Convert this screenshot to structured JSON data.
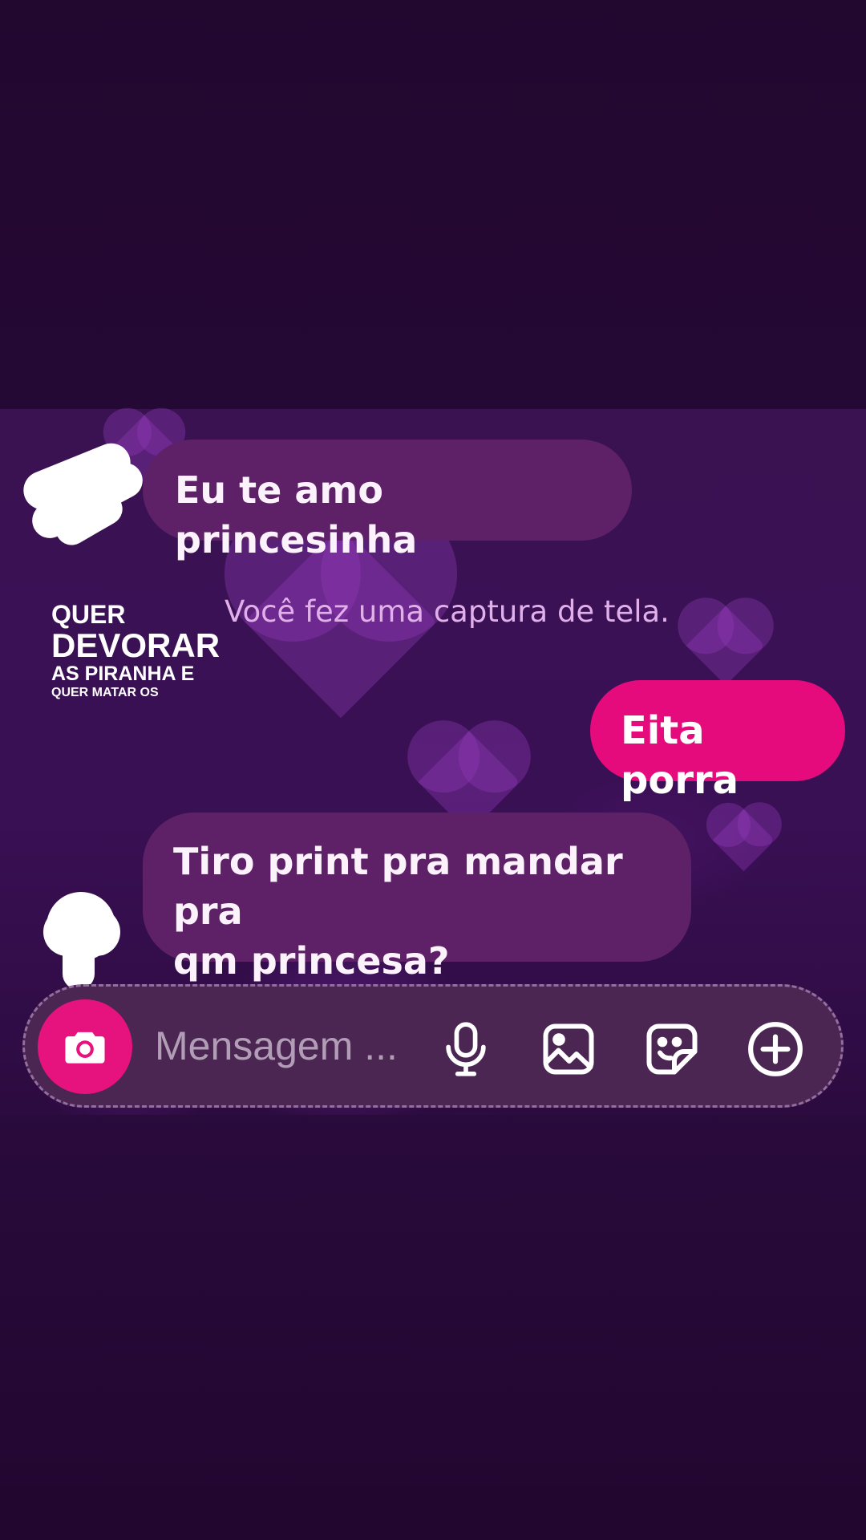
{
  "messages": [
    {
      "direction": "received",
      "text": "Eu te amo princesinha"
    },
    {
      "direction": "notice",
      "text": "Você fez uma captura de tela."
    },
    {
      "direction": "sent",
      "text": "Eita porra"
    },
    {
      "direction": "received",
      "text_lines": [
        "Tiro print pra mandar pra",
        "qm princesa?"
      ]
    }
  ],
  "overlay": {
    "line1": "QUER",
    "line2": "DEVORAR",
    "line3": "AS PIRANHA E",
    "line4": "QUER MATAR OS"
  },
  "composer": {
    "placeholder": "Mensagem ...",
    "icons": [
      "camera-icon",
      "microphone-icon",
      "gallery-icon",
      "sticker-icon",
      "plus-icon"
    ]
  },
  "colors": {
    "background": "#230833",
    "received_bubble": "#5e2167",
    "sent_bubble": "#e60b7d",
    "notice_text": "#e1b0ea",
    "composer_bg": "#4b2653",
    "camera_button": "#e6137e"
  }
}
